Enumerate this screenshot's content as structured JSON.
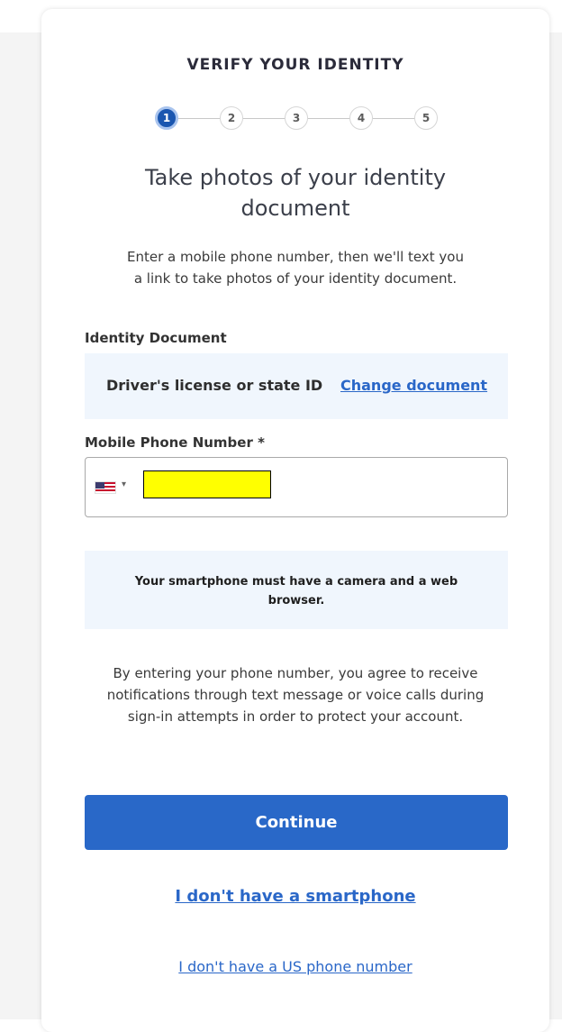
{
  "header": {
    "title": "VERIFY YOUR IDENTITY"
  },
  "stepper": {
    "current": 1,
    "steps": [
      "1",
      "2",
      "3",
      "4",
      "5"
    ]
  },
  "main": {
    "heading": "Take photos of your identity document",
    "lead": "Enter a mobile phone number, then we'll text you a link to take photos of your identity document."
  },
  "identity_document": {
    "label": "Identity Document",
    "value": "Driver's license or state ID",
    "change_link": "Change document"
  },
  "phone": {
    "label": "Mobile Phone Number *",
    "country": "US",
    "value": ""
  },
  "info": {
    "text": "Your smartphone must have a camera and a web browser."
  },
  "consent": {
    "text": "By entering your phone number, you agree to receive notifications through text message or voice calls during sign-in attempts in order to protect your account."
  },
  "actions": {
    "continue_label": "Continue",
    "no_smartphone_link": "I don't have a smartphone",
    "no_us_number_link": "I don't have a US phone number"
  },
  "colors": {
    "primary": "#2968c8",
    "link": "#2a67c8",
    "panel": "#f0f6fd",
    "step_active": "#1a56b0"
  }
}
